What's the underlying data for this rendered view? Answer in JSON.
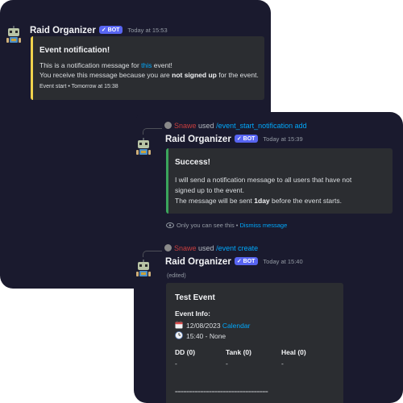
{
  "colors": {
    "background": "#1a1a2e",
    "embed_background": "#2b2d31",
    "accent_yellow": "#f0d34c",
    "accent_green": "#3ba55c",
    "link": "#00a8fc",
    "bot_tag": "#5865f2",
    "username_red": "#c93e3e"
  },
  "message1": {
    "author": "Raid Organizer",
    "bot_tag": "BOT",
    "bot_check": "✓",
    "timestamp": "Today at 15:53",
    "embed": {
      "title": "Event notification!",
      "line1_prefix": "This is a notification message for ",
      "line1_link": "this",
      "line1_suffix": " event!",
      "line2_prefix": "You receive this message because you are ",
      "line2_bold": "not signed up",
      "line2_suffix": " for the event.",
      "footer": "Event start • Tomorrow at 15:38"
    }
  },
  "message2": {
    "reply_user": "Snawe",
    "reply_used": "used",
    "reply_command": "/event_start_notification add",
    "author": "Raid Organizer",
    "bot_tag": "BOT",
    "bot_check": "✓",
    "timestamp": "Today at 15:39",
    "embed": {
      "title": "Success!",
      "line1": "I will send a notification message to all users that have not",
      "line2": "signed up to the event.",
      "line3_prefix": "The message will be sent ",
      "line3_bold": "1day",
      "line3_suffix": " before the event starts."
    },
    "ephemeral_icon": "eye-icon",
    "ephemeral_text": "Only you can see this • ",
    "dismiss_label": "Dismiss message"
  },
  "message3": {
    "reply_user": "Snawe",
    "reply_used": "used",
    "reply_command": "/event create",
    "author": "Raid Organizer",
    "bot_tag": "BOT",
    "bot_check": "✓",
    "timestamp": "Today at 15:40",
    "edited": "(edited)",
    "embed": {
      "title": "Test Event",
      "info_label": "Event Info:",
      "date": "12/08/2023",
      "calendar_link": "Calendar",
      "calendar_icon": "calendar-icon",
      "time": "15:40",
      "time_suffix": " - None",
      "clock_icon": "clock-icon",
      "fields": [
        {
          "name": "DD (0)",
          "value": "-"
        },
        {
          "name": "Tank (0)",
          "value": "-"
        },
        {
          "name": "Heal (0)",
          "value": "-"
        }
      ],
      "separator": "================================="
    }
  }
}
